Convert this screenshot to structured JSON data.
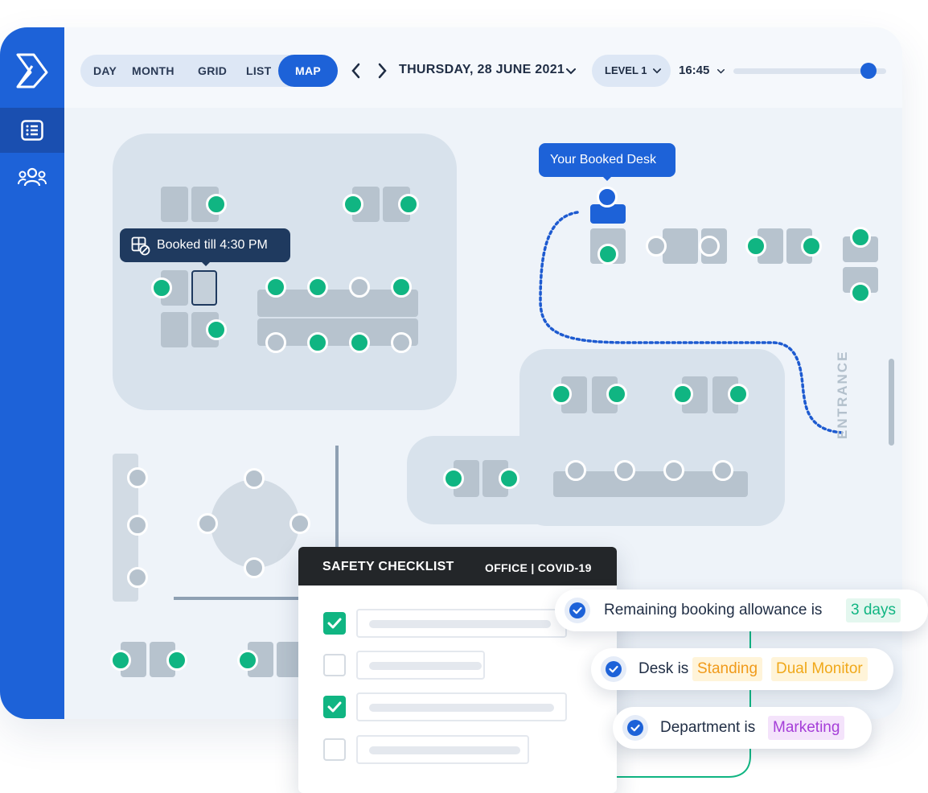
{
  "nav": {
    "views": [
      "DAY",
      "MONTH",
      "GRID",
      "LIST",
      "MAP"
    ],
    "active_view": "MAP",
    "date": "THURSDAY, 28 JUNE 2021",
    "level": "LEVEL 1",
    "time": "16:45",
    "time_slider_fraction": 0.88
  },
  "map": {
    "booked_till_tooltip": "Booked till 4:30 PM",
    "your_desk_tooltip": "Your Booked Desk",
    "entrance_label": "ENTRANCE"
  },
  "checklist": {
    "title": "SAFETY CHECKLIST",
    "subtitle": "OFFICE | COVID-19",
    "items": [
      {
        "checked": true
      },
      {
        "checked": false
      },
      {
        "checked": true
      },
      {
        "checked": false
      }
    ]
  },
  "criteria": [
    {
      "text": "Remaining booking allowance is",
      "tags": [
        {
          "label": "3 days",
          "color": "#10b582",
          "bg": "#e4f7ef"
        }
      ]
    },
    {
      "text": "Desk is",
      "tags": [
        {
          "label": "Standing",
          "color": "#f09a1a",
          "bg": "#fff4d9"
        },
        {
          "label": "Dual Monitor",
          "color": "#f0a81a",
          "bg": "#fff4d9"
        }
      ]
    },
    {
      "text": "Department is",
      "tags": [
        {
          "label": "Marketing",
          "color": "#a53ed8",
          "bg": "#f4e3fb"
        }
      ]
    }
  ],
  "colors": {
    "brand": "#1d62d8",
    "available": "#10b582",
    "occupied": "#b6c2cd",
    "tooltip_dark": "#1f3a5f"
  }
}
